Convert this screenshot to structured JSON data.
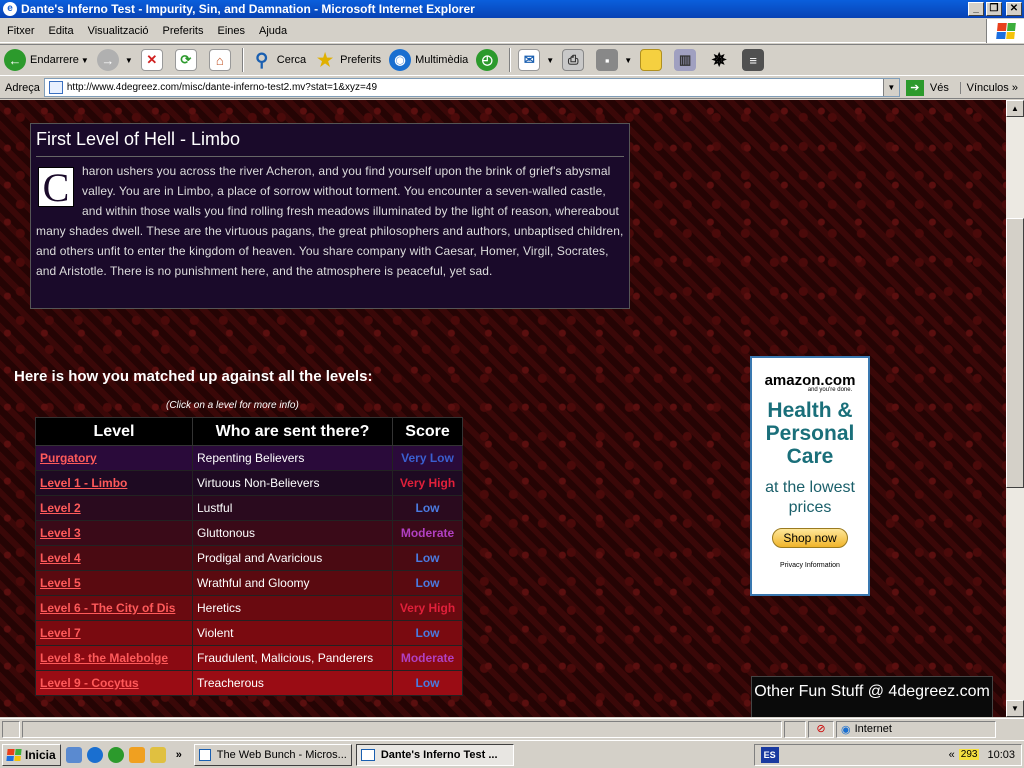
{
  "window": {
    "title": "Dante's Inferno Test - Impurity, Sin, and Damnation - Microsoft Internet Explorer",
    "ie_icon": "e"
  },
  "menu": [
    "Fitxer",
    "Edita",
    "Visualització",
    "Preferits",
    "Eines",
    "Ajuda"
  ],
  "toolbar": {
    "back": "Endarrere",
    "search": "Cerca",
    "favorites": "Preferits",
    "media": "Multimèdia"
  },
  "address": {
    "label": "Adreça",
    "url": "http://www.4degreez.com/misc/dante-inferno-test2.mv?stat=1&xyz=49",
    "go": "Vés",
    "links": "Vínculos"
  },
  "page": {
    "level_title": "First Level of Hell - Limbo",
    "dropcap": "C",
    "description": "haron ushers you across the river Acheron, and you find yourself upon the brink of grief's abysmal valley. You are in Limbo, a place of sorrow without torment. You encounter a seven-walled castle, and within those walls you find rolling fresh meadows illuminated by the light of reason, whereabout many shades dwell. These are the virtuous pagans, the great philosophers and authors, unbaptised children, and others unfit to enter the kingdom of heaven. You share company with Caesar, Homer, Virgil, Socrates, and Aristotle. There is no punishment here, and the atmosphere is peaceful, yet sad.",
    "matched_heading": "Here is how you matched up against all the levels:",
    "click_hint": "(Click on a level for more info)",
    "table_headers": [
      "Level",
      "Who are sent there?",
      "Score"
    ],
    "rows": [
      {
        "level": "Purgatory",
        "who": "Repenting Believers",
        "score": "Very Low",
        "bg": "#2a0a3a",
        "score_color": "#3a5fd0"
      },
      {
        "level": "Level 1 - Limbo",
        "who": "Virtuous Non-Believers",
        "score": "Very High",
        "bg": "#1e0a22",
        "score_color": "#e0203a"
      },
      {
        "level": "Level 2",
        "who": "Lustful",
        "score": "Low",
        "bg": "#2a0a1e",
        "score_color": "#4a7ae0"
      },
      {
        "level": "Level 3",
        "who": "Gluttonous",
        "score": "Moderate",
        "bg": "#3a0a18",
        "score_color": "#b040c0"
      },
      {
        "level": "Level 4",
        "who": "Prodigal and Avaricious",
        "score": "Low",
        "bg": "#4a0a12",
        "score_color": "#4a7ae0"
      },
      {
        "level": "Level 5",
        "who": "Wrathful and Gloomy",
        "score": "Low",
        "bg": "#5a0a10",
        "score_color": "#4a7ae0"
      },
      {
        "level": "Level 6 - The City of Dis",
        "who": "Heretics",
        "score": "Very High",
        "bg": "#6a0a10",
        "score_color": "#e0203a"
      },
      {
        "level": "Level 7",
        "who": "Violent",
        "score": "Low",
        "bg": "#7a0a10",
        "score_color": "#4a7ae0"
      },
      {
        "level": "Level 8- the Malebolge",
        "who": "Fraudulent, Malicious, Panderers",
        "score": "Moderate",
        "bg": "#8a0a12",
        "score_color": "#b040c0"
      },
      {
        "level": "Level 9 - Cocytus",
        "who": "Treacherous",
        "score": "Low",
        "bg": "#9a0c14",
        "score_color": "#4a7ae0"
      }
    ],
    "ad": {
      "logo": "amazon.com",
      "tag": "and you're done.",
      "headline": "Health & Personal Care",
      "sub": "at the lowest prices",
      "button": "Shop now",
      "privacy": "Privacy Information"
    },
    "other_fun": "Other Fun Stuff @ 4degreez.com"
  },
  "status": {
    "zone": "Internet"
  },
  "taskbar": {
    "start": "Inicia",
    "tasks": [
      "The Web Bunch - Micros...",
      "Dante's Inferno Test ..."
    ],
    "lang": "ES",
    "tray_count": "293",
    "clock": "10:03"
  }
}
